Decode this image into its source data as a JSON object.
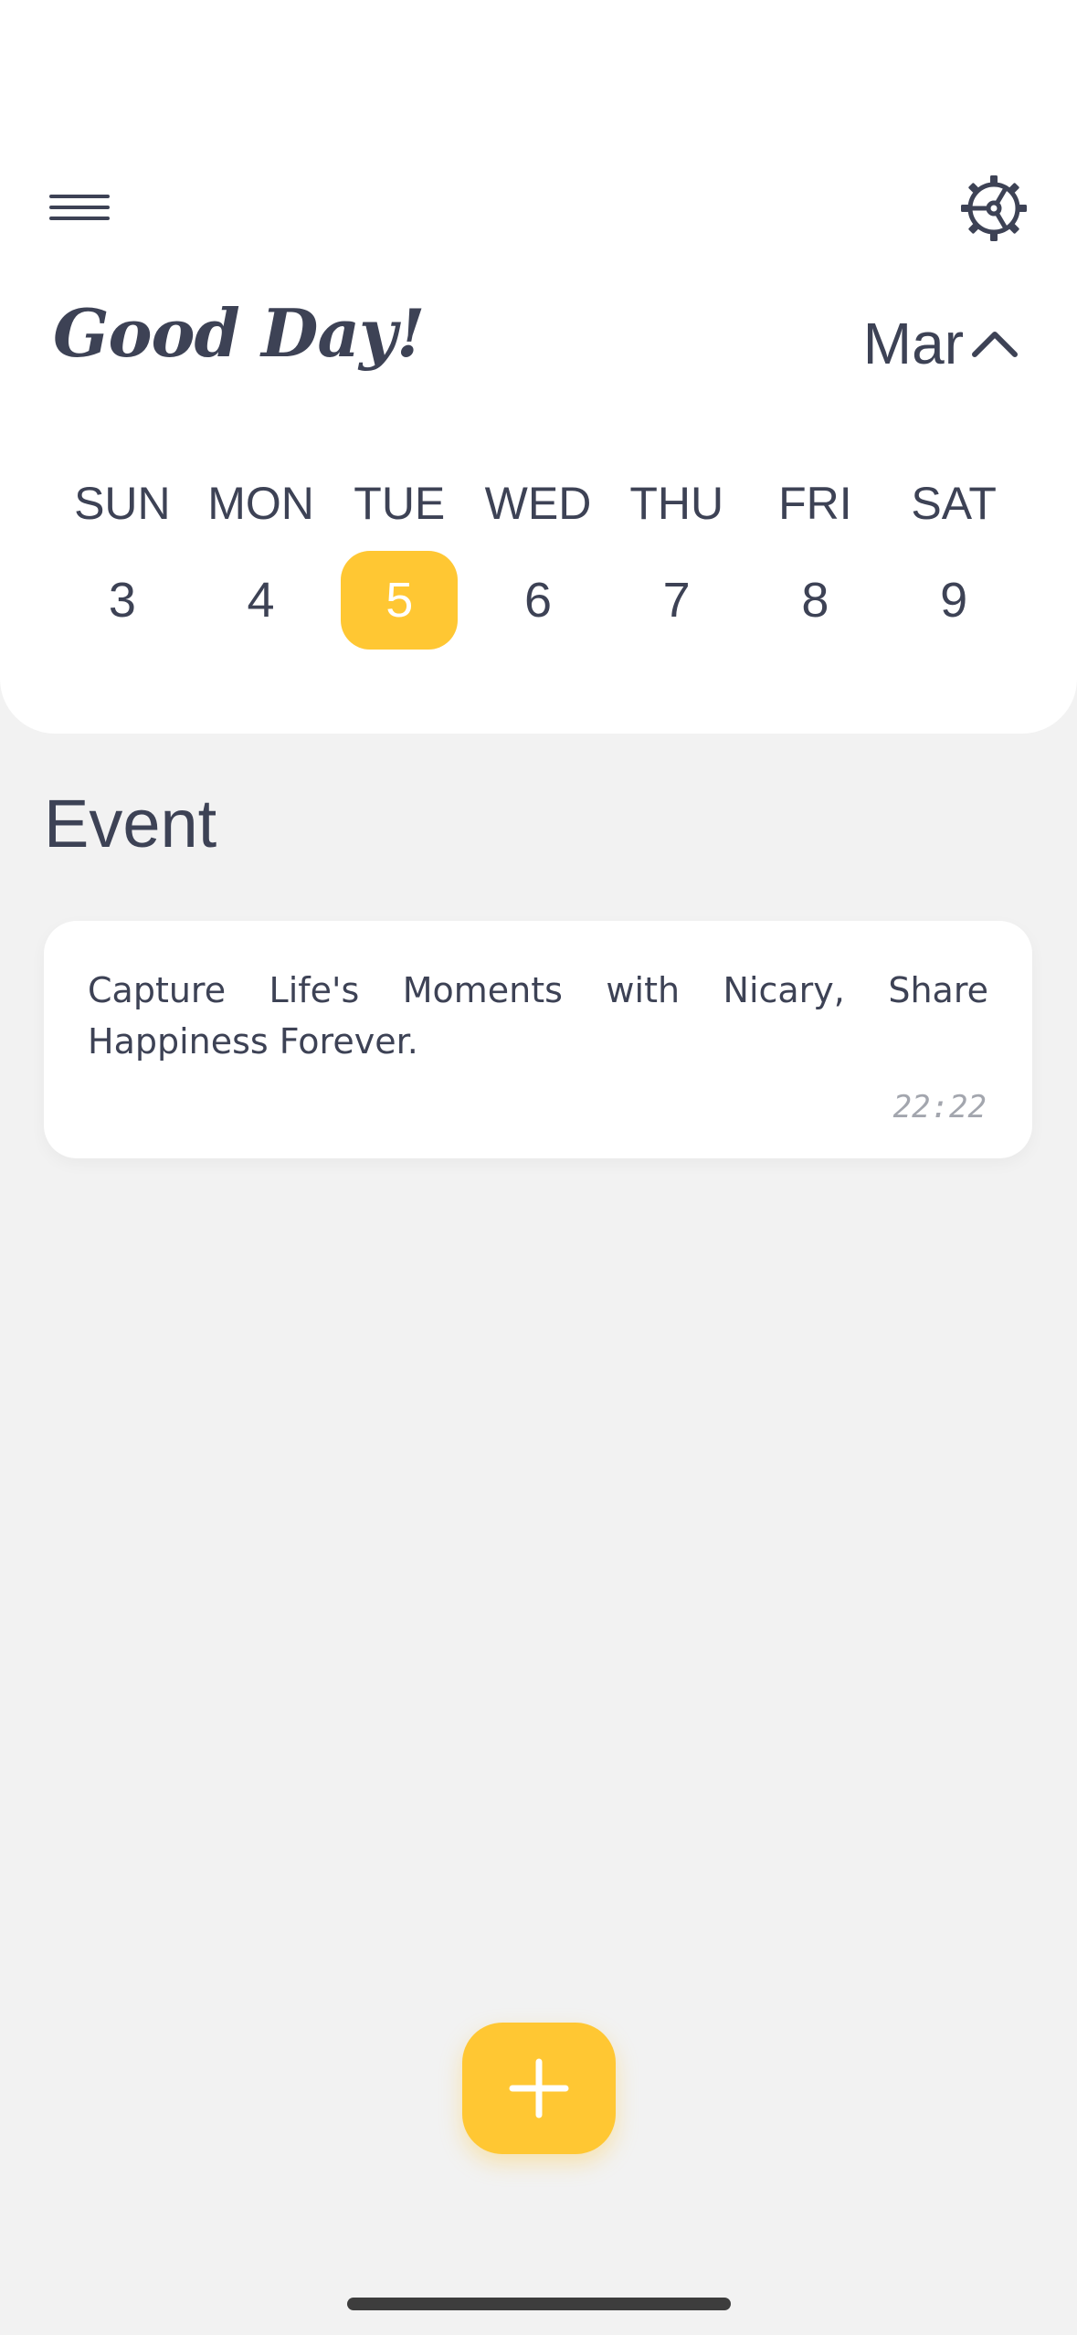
{
  "header": {
    "greeting": "Good Day!",
    "menu_icon": "hamburger-menu-icon",
    "settings_icon": "gear-icon"
  },
  "month_selector": {
    "label": "Mar",
    "icon": "chevron-up-icon"
  },
  "calendar": {
    "weekdays": [
      "SUN",
      "MON",
      "TUE",
      "WED",
      "THU",
      "FRI",
      "SAT"
    ],
    "days": [
      "3",
      "4",
      "5",
      "6",
      "7",
      "8",
      "9"
    ],
    "selected_day": "5"
  },
  "events": {
    "title": "Event",
    "items": [
      {
        "text": "Capture Life's Moments with Nicary, Share Happiness Forever.",
        "time": "22:22"
      }
    ]
  },
  "fab": {
    "icon": "plus-icon"
  },
  "colors": {
    "accent": "#ffc733",
    "text": "#3d4255",
    "background": "#f2f2f2",
    "card": "#ffffff",
    "muted_text": "#a3a6ae"
  }
}
